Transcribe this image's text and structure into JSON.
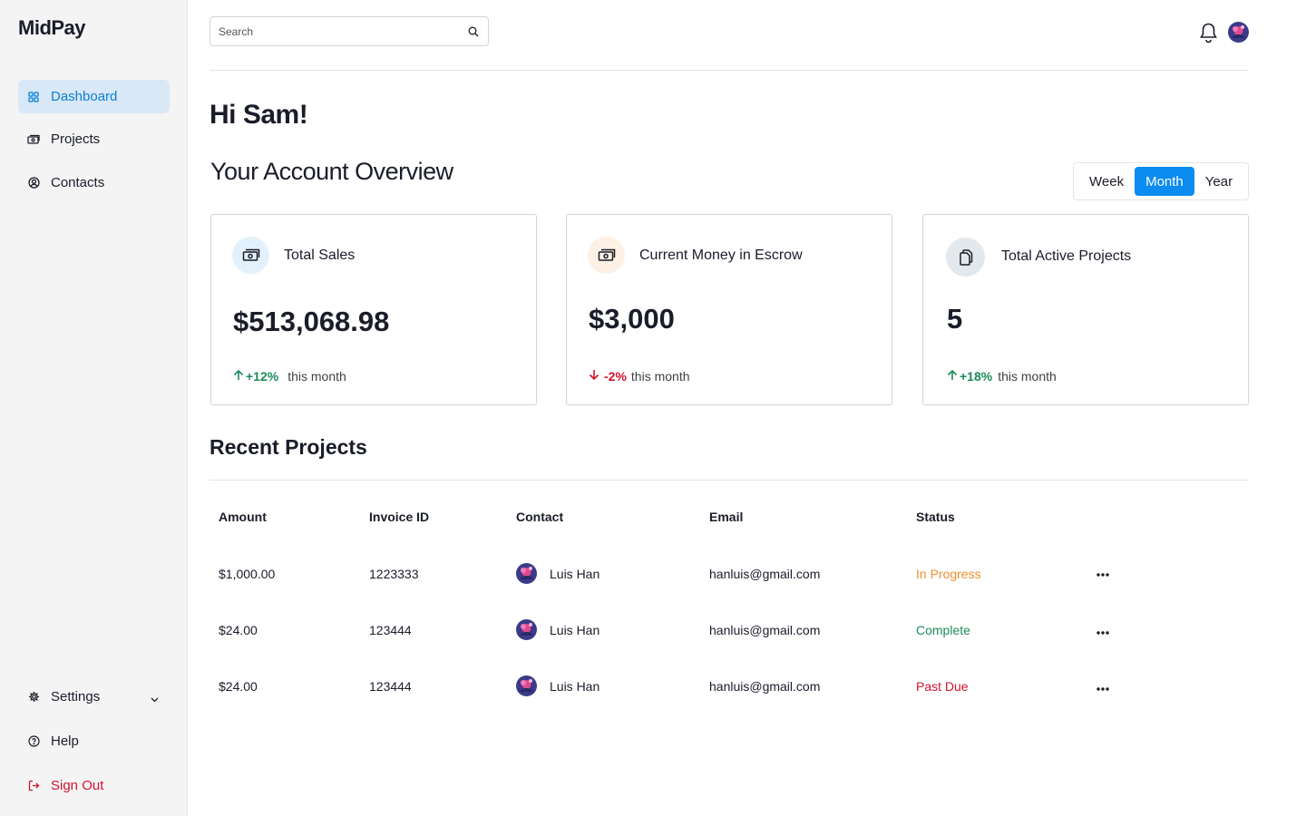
{
  "app": {
    "logo_main": "MidPay"
  },
  "sidebar": {
    "items": [
      {
        "label": "Dashboard"
      },
      {
        "label": "Projects"
      },
      {
        "label": "Contacts"
      }
    ],
    "bottom": [
      {
        "label": "Settings"
      },
      {
        "label": "Help"
      },
      {
        "label": "Sign Out"
      }
    ]
  },
  "header": {
    "search_placeholder": "Search"
  },
  "greeting": "Hi Sam!",
  "overview": {
    "title": "Your Account Overview",
    "periods": [
      "Week",
      "Month",
      "Year"
    ],
    "selected_period": "Month"
  },
  "cards": [
    {
      "title": "Total Sales",
      "value": "$513,068.98",
      "change": "+12%",
      "direction": "up",
      "period": "this month"
    },
    {
      "title": "Current Money in Escrow",
      "value": "$3,000",
      "change": "-2%",
      "direction": "down",
      "period": "this month"
    },
    {
      "title": "Total Active Projects",
      "value": "5",
      "change": "+18%",
      "direction": "up",
      "period": "this month"
    }
  ],
  "recent": {
    "title": "Recent Projects",
    "columns": [
      "Amount",
      "Invoice ID",
      "Contact",
      "Email",
      "Status"
    ],
    "rows": [
      {
        "amount": "$1,000.00",
        "invoice": "1223333",
        "contact": "Luis Han",
        "email": "hanluis@gmail.com",
        "status": "In Progress"
      },
      {
        "amount": "$24.00",
        "invoice": "123444",
        "contact": "Luis Han",
        "email": "hanluis@gmail.com",
        "status": "Complete"
      },
      {
        "amount": "$24.00",
        "invoice": "123444",
        "contact": "Luis Han",
        "email": "hanluis@gmail.com",
        "status": "Past Due"
      }
    ]
  },
  "colors": {
    "accent": "#0a8cf0",
    "status_in_progress": "#ef8f2e",
    "status_complete": "#1c8a5a",
    "status_past_due": "#d3132f"
  }
}
